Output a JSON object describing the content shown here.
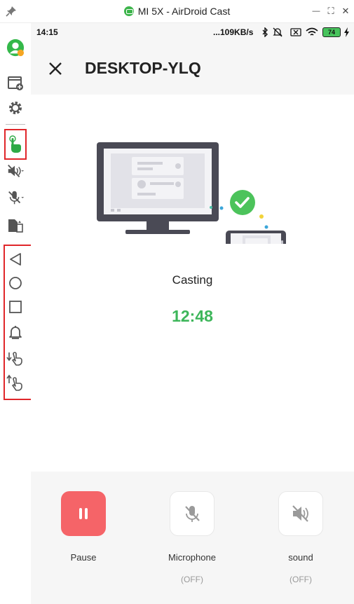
{
  "window": {
    "title": "MI 5X - AirDroid Cast",
    "controls": {
      "minimize": "—",
      "restore": "⛶",
      "close": "✕"
    }
  },
  "sidebar": {
    "items": [
      "avatar",
      "add-window-icon",
      "gear-icon",
      "touch-control-icon",
      "sound-off-icon",
      "microphone-off-icon",
      "file-transfer-icon",
      "back-icon",
      "home-icon",
      "recents-icon",
      "notification-bell-icon",
      "swipe-down-icon",
      "swipe-up-icon"
    ],
    "highlight_color": "#e0262a"
  },
  "status_bar": {
    "time": "14:15",
    "network_speed": "...109KB/s",
    "battery": "74"
  },
  "header": {
    "device_name": "DESKTOP-YLQ"
  },
  "cast": {
    "status": "Casting",
    "timer": "12:48",
    "timer_color": "#3db65a"
  },
  "controls": {
    "pause": {
      "label": "Pause"
    },
    "microphone": {
      "label": "Microphone",
      "state": "(OFF)"
    },
    "sound": {
      "label": "sound",
      "state": "(OFF)"
    },
    "pause_color": "#f56468"
  }
}
